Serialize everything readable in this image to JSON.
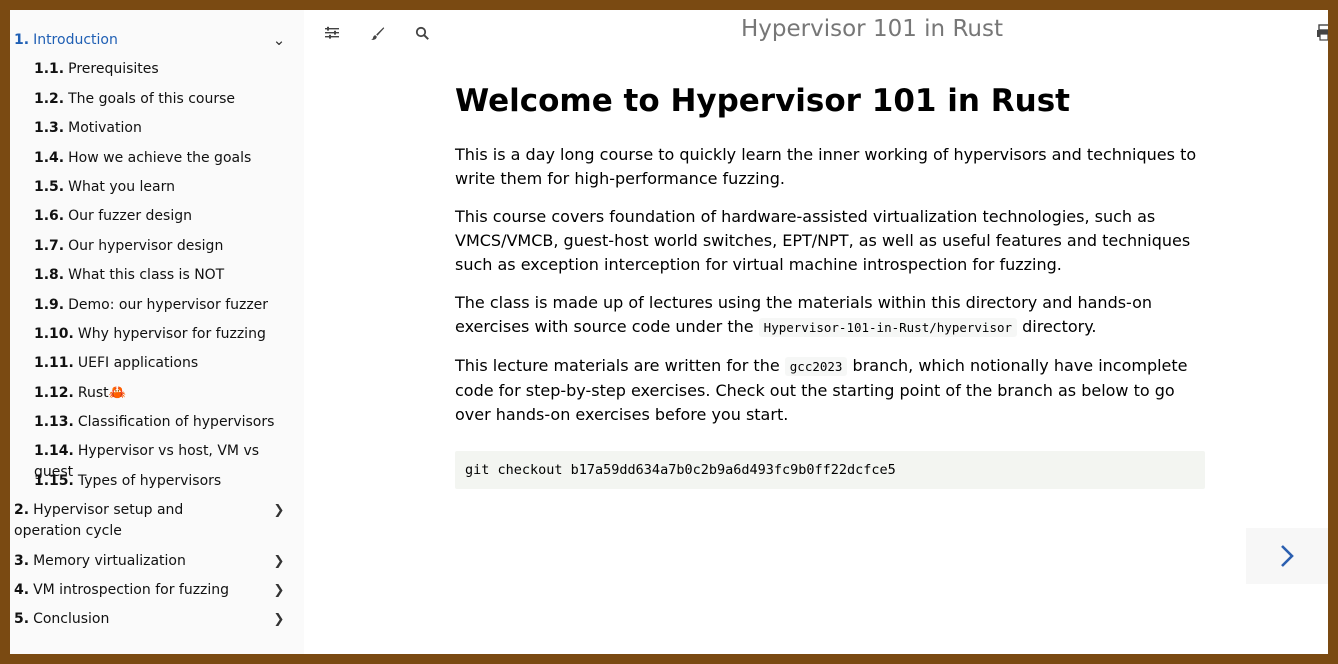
{
  "sidebar": {
    "items": [
      {
        "num": "1.",
        "label": "Introduction",
        "chevron": "⌄"
      },
      {
        "num": "1.1.",
        "label": "Prerequisites"
      },
      {
        "num": "1.2.",
        "label": "The goals of this course"
      },
      {
        "num": "1.3.",
        "label": "Motivation"
      },
      {
        "num": "1.4.",
        "label": "How we achieve the goals"
      },
      {
        "num": "1.5.",
        "label": "What you learn"
      },
      {
        "num": "1.6.",
        "label": "Our fuzzer design"
      },
      {
        "num": "1.7.",
        "label": "Our hypervisor design"
      },
      {
        "num": "1.8.",
        "label": "What this class is NOT"
      },
      {
        "num": "1.9.",
        "label": "Demo: our hypervisor fuzzer"
      },
      {
        "num": "1.10.",
        "label": "Why hypervisor for fuzzing"
      },
      {
        "num": "1.11.",
        "label": "UEFI applications"
      },
      {
        "num": "1.12.",
        "label": "Rust🦀"
      },
      {
        "num": "1.13.",
        "label": "Classification of hypervisors"
      },
      {
        "num": "1.14.",
        "label": "Hypervisor vs host, VM vs guest"
      },
      {
        "num": "1.15.",
        "label": "Types of hypervisors"
      },
      {
        "num": "2.",
        "label": "Hypervisor setup and operation cycle",
        "chevron": "❯"
      },
      {
        "num": "3.",
        "label": "Memory virtualization",
        "chevron": "❯"
      },
      {
        "num": "4.",
        "label": "VM introspection for fuzzing",
        "chevron": "❯"
      },
      {
        "num": "5.",
        "label": "Conclusion",
        "chevron": "❯"
      }
    ]
  },
  "toolbar": {
    "icons": [
      "menu-icon",
      "paintbrush-icon",
      "search-icon",
      "print-icon"
    ]
  },
  "menu_title": "Hypervisor 101 in Rust",
  "content": {
    "heading": "Welcome to Hypervisor 101 in Rust",
    "p1": "This is a day long course to quickly learn the inner working of hypervisors and techniques to write them for high-performance fuzzing.",
    "p2": "This course covers foundation of hardware-assisted virtualization technologies, such as VMCS/VMCB, guest-host world switches, EPT/NPT, as well as useful features and techniques such as exception interception for virtual machine introspection for fuzzing.",
    "p3_a": "The class is made up of lectures using the materials within this directory and hands-on exercises with source code under the ",
    "p3_code": "Hypervisor-101-in-Rust/hypervisor",
    "p3_b": " directory.",
    "p4_a": "This lecture materials are written for the ",
    "p4_code": "gcc2023",
    "p4_b": " branch, which notionally have incomplete code for step-by-step exercises. Check out the starting point of the branch as below to go over hands-on exercises before you start.",
    "code_block": "git checkout b17a59dd634a7b0c2b9a6d493fc9b0ff22dcfce5"
  },
  "colors": {
    "frame": "#7a4a12",
    "active_link": "#1f5fb4",
    "nav_arrow": "#2b5fb0"
  }
}
